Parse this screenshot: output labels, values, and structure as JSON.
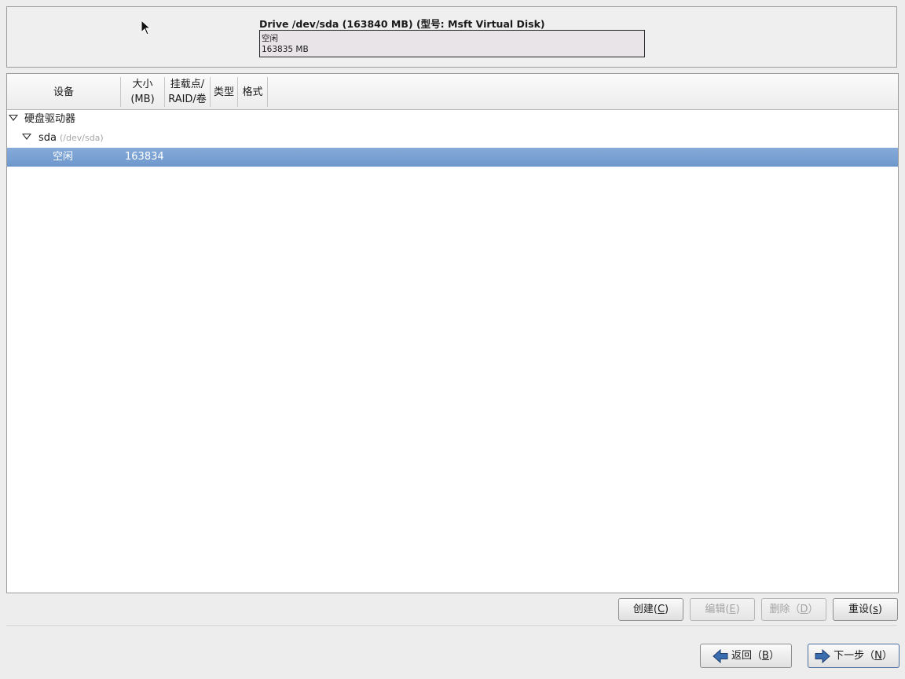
{
  "drive": {
    "title": "Drive /dev/sda (163840 MB) (型号: Msft Virtual Disk)",
    "segment": {
      "label": "空闲",
      "size": "163835 MB"
    }
  },
  "table": {
    "columns": {
      "device": "设备",
      "size_line1": "大小",
      "size_line2": "(MB)",
      "mount_line1": "挂载点/",
      "mount_line2": "RAID/卷",
      "type": "类型",
      "format": "格式"
    },
    "rows": {
      "hard_drives": {
        "label": "硬盘驱动器"
      },
      "sda": {
        "label": "sda",
        "path": "(/dev/sda)"
      },
      "free": {
        "label": "空闲",
        "size": "163834",
        "selected": true
      }
    }
  },
  "actions": {
    "create": {
      "label": "创建(",
      "mnemonic": "C",
      "suffix": ")"
    },
    "edit": {
      "label": "编辑(",
      "mnemonic": "E",
      "suffix": ")"
    },
    "delete": {
      "label": "删除（",
      "mnemonic": "D",
      "suffix": "）"
    },
    "reset": {
      "label": "重设(",
      "mnemonic": "s",
      "suffix": ")"
    }
  },
  "nav": {
    "back": {
      "label": "返回（",
      "mnemonic": "B",
      "suffix": "）",
      "icon": "arrow-left-icon"
    },
    "next": {
      "label": "下一步（",
      "mnemonic": "N",
      "suffix": "）",
      "icon": "arrow-right-icon"
    }
  },
  "colors": {
    "selection": "#7aa1d2",
    "arrow": "#3a6db0"
  }
}
